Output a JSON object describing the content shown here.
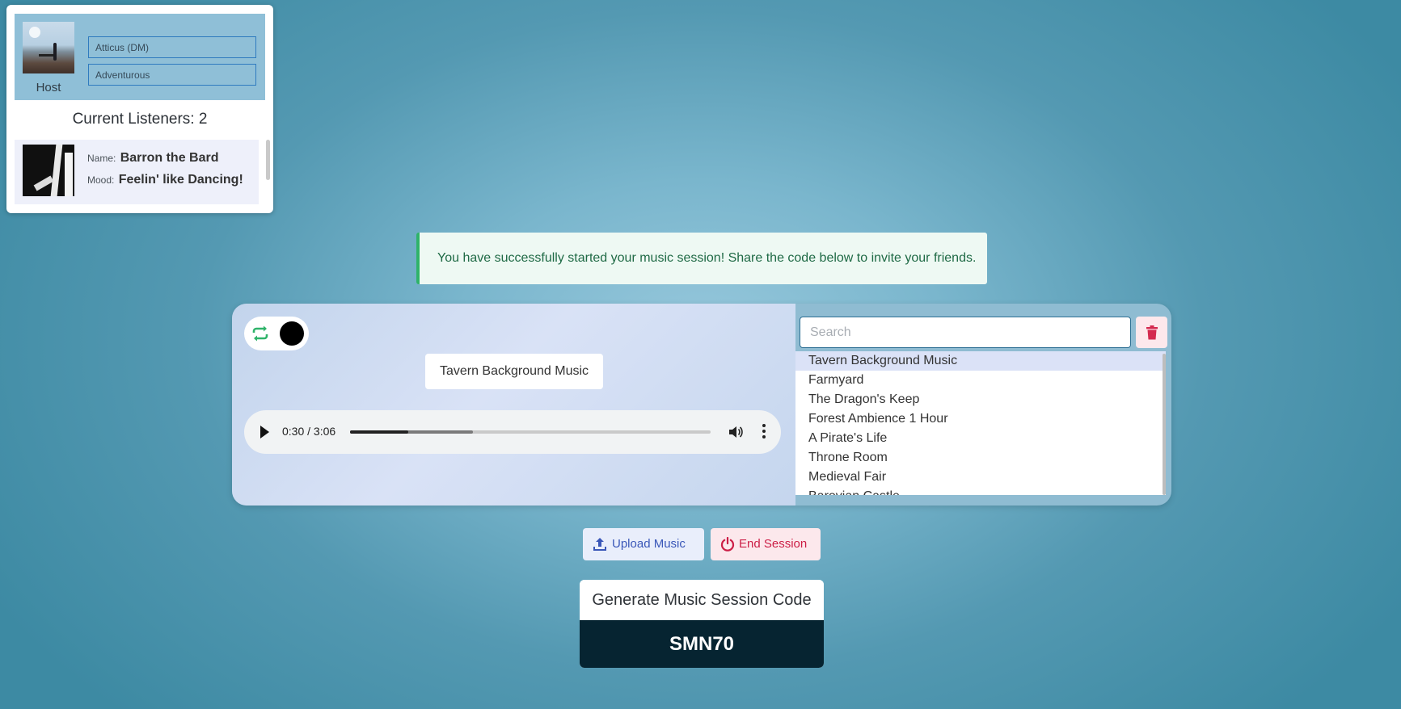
{
  "host": {
    "label": "Host",
    "name_value": "Atticus (DM)",
    "mood_value": "Adventurous",
    "avatar_icon": "host-avatar-photo"
  },
  "listeners": {
    "title": "Current Listeners: 2",
    "items": [
      {
        "name_label": "Name:",
        "name": "Barron the Bard",
        "mood_label": "Mood:",
        "mood": "Feelin' like Dancing!"
      }
    ]
  },
  "alert": {
    "message": "You have successfully started your music session! Share the code below to invite your friends.",
    "color": "#2fb36a"
  },
  "player": {
    "now_playing": "Tavern Background Music",
    "time": "0:30 / 3:06",
    "progress": 0.161,
    "buffered": 0.34,
    "repeat_color": "#2fb36a"
  },
  "search": {
    "placeholder": "Search"
  },
  "tracks": [
    "Tavern Background Music",
    "Farmyard",
    "The Dragon's Keep",
    "Forest Ambience 1 Hour",
    "A Pirate's Life",
    "Throne Room",
    "Medieval Fair",
    "Barovian Castle"
  ],
  "actions": {
    "upload_label": "Upload Music",
    "end_label": "End Session"
  },
  "code": {
    "generate_label": "Generate Music Session Code",
    "value": "SMN70"
  }
}
